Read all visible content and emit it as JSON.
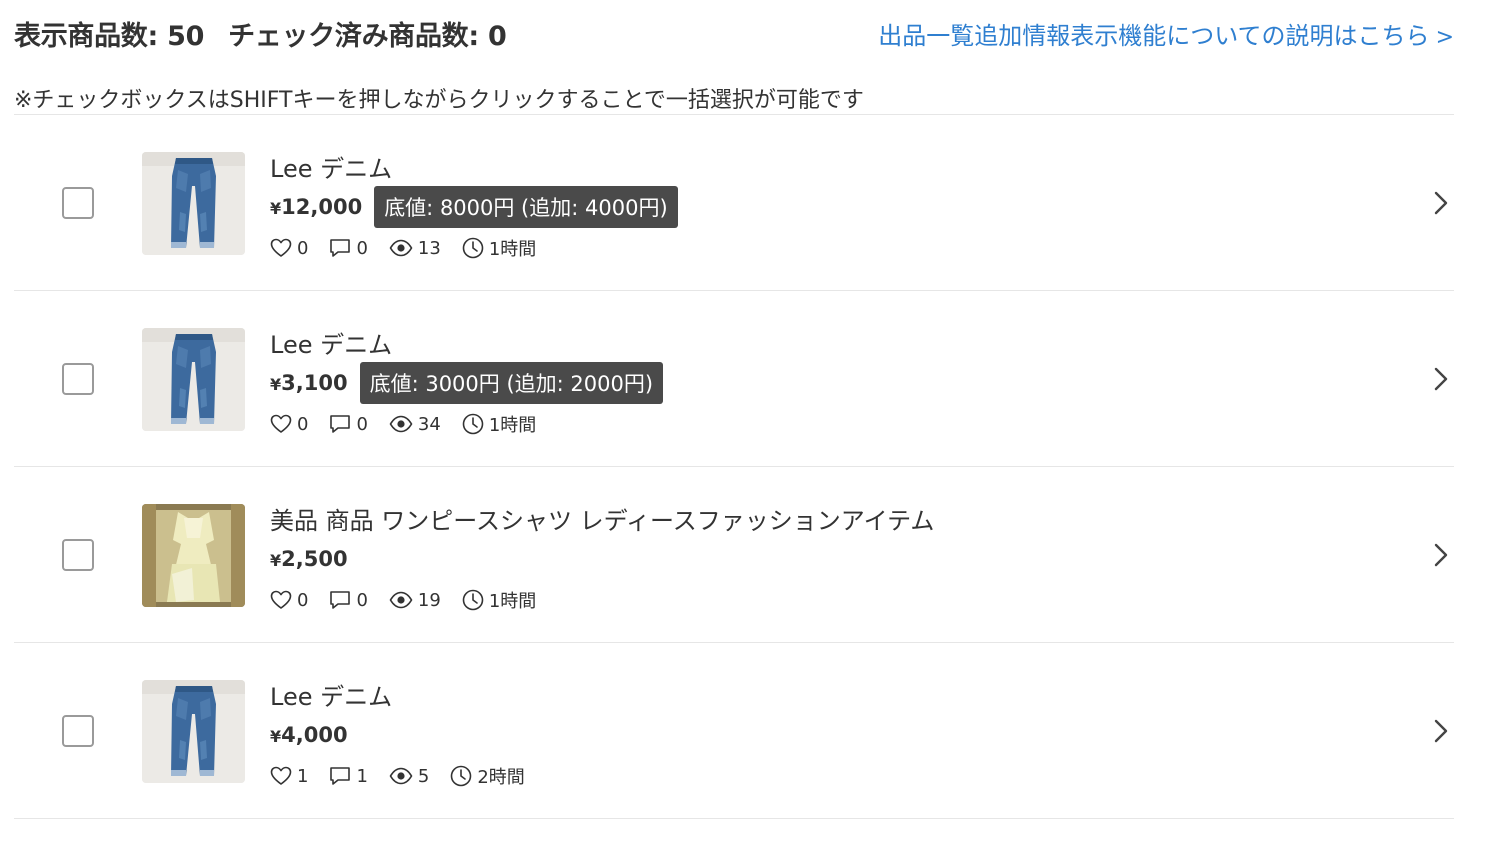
{
  "header": {
    "shown_count_label": "表示商品数: 50",
    "checked_count_label": "チェック済み商品数: 0",
    "help_link": "出品一覧追加情報表示機能についての説明はこちら",
    "help_link_chevron": ">"
  },
  "note": "※チェックボックスはSHIFTキーを押しながらクリックすることで一括選択が可能です",
  "items": [
    {
      "title": "Lee デニム",
      "price": "12,000",
      "badge": "底値: 8000円 (追加: 4000円)",
      "likes": "0",
      "comments": "0",
      "views": "13",
      "time": "1時間",
      "thumb": "jeans"
    },
    {
      "title": "Lee デニム",
      "price": "3,100",
      "badge": "底値: 3000円 (追加: 2000円)",
      "likes": "0",
      "comments": "0",
      "views": "34",
      "time": "1時間",
      "thumb": "jeans"
    },
    {
      "title": "美品 商品 ワンピースシャツ レディースファッションアイテム",
      "price": "2,500",
      "badge": "",
      "likes": "0",
      "comments": "0",
      "views": "19",
      "time": "1時間",
      "thumb": "dress"
    },
    {
      "title": "Lee デニム",
      "price": "4,000",
      "badge": "",
      "likes": "1",
      "comments": "1",
      "views": "5",
      "time": "2時間",
      "thumb": "jeans"
    }
  ],
  "currency_symbol": "¥",
  "colors": {
    "link": "#2f7fd0",
    "badge_bg": "#4a4a4a",
    "divider": "#e6e6e6"
  },
  "icons": {
    "like": "heart-icon",
    "comment": "comment-icon",
    "view": "eye-icon",
    "time": "clock-icon",
    "open": "chevron-right-icon"
  }
}
